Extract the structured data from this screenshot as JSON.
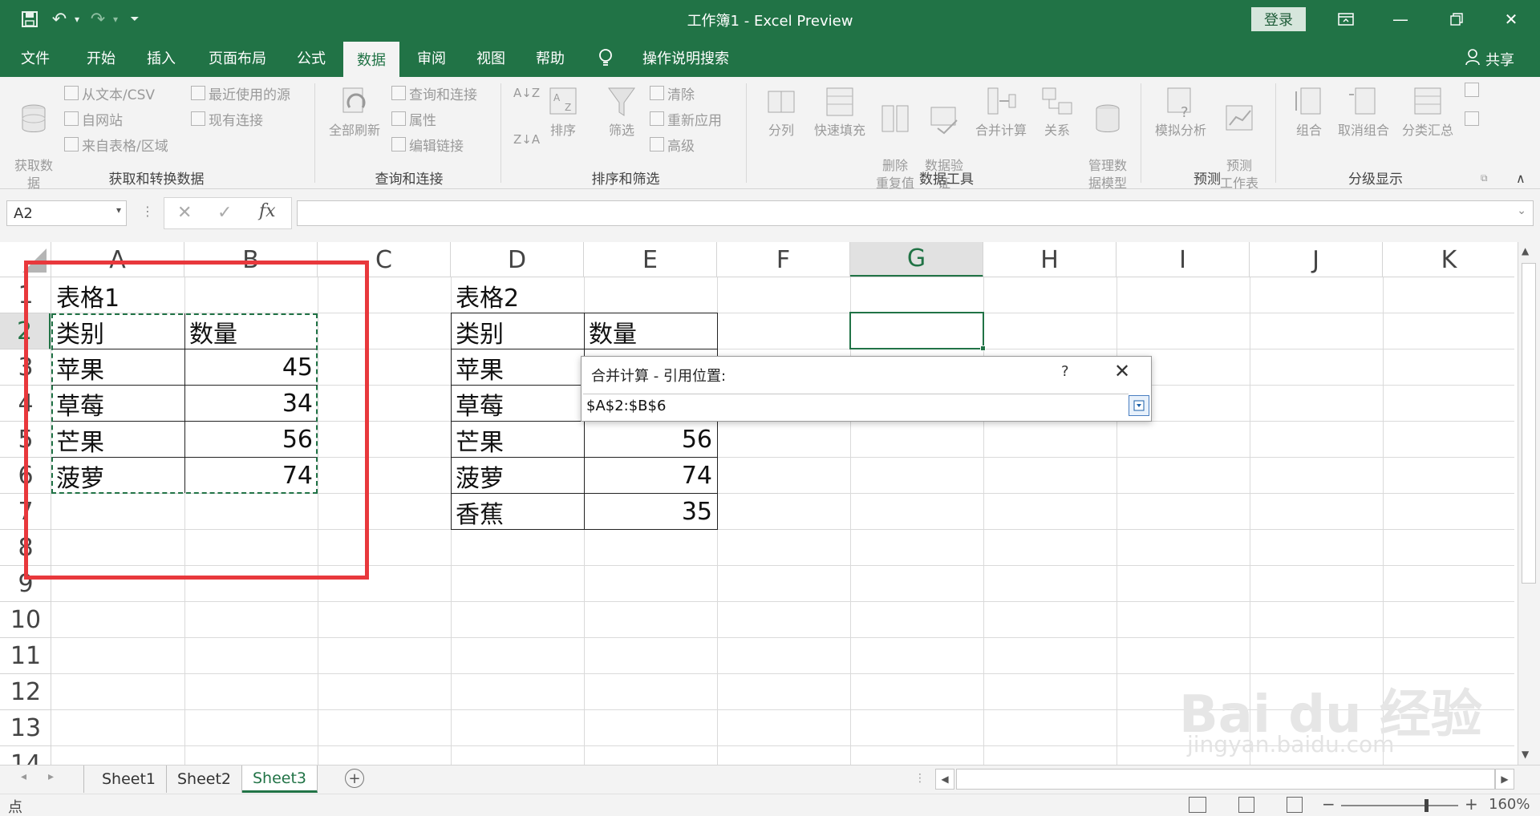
{
  "titlebar": {
    "title": "工作簿1  -  Excel Preview",
    "login": "登录",
    "undo_icon": "undo-icon",
    "redo_icon": "redo-icon",
    "save_icon": "save-icon"
  },
  "tabs": [
    "文件",
    "开始",
    "插入",
    "页面布局",
    "公式",
    "数据",
    "审阅",
    "视图",
    "帮助",
    "操作说明搜索"
  ],
  "share": "共享",
  "ribbon": {
    "get_data": "获取数\n据",
    "from_text_csv": "从文本/CSV",
    "from_web": "自网站",
    "from_table": "来自表格/区域",
    "recent_sources": "最近使用的源",
    "existing_connections": "现有连接",
    "group_get_transform": "获取和转换数据",
    "refresh_all": "全部刷新",
    "queries_connections": "查询和连接",
    "properties": "属性",
    "edit_links": "编辑链接",
    "group_queries": "查询和连接",
    "sort": "排序",
    "filter": "筛选",
    "clear": "清除",
    "reapply": "重新应用",
    "advanced": "高级",
    "group_sort_filter": "排序和筛选",
    "text_to_columns": "分列",
    "flash_fill": "快速填充",
    "remove_duplicates": "删除\n重复值",
    "data_validation": "数据验\n证",
    "consolidate": "合并计算",
    "relationships": "关系",
    "manage_data_model": "管理数\n据模型",
    "group_data_tools": "数据工具",
    "what_if": "模拟分析",
    "forecast_sheet": "预测\n工作表",
    "group_forecast": "预测",
    "group": "组合",
    "ungroup": "取消组合",
    "subtotal": "分类汇总",
    "group_outline": "分级显示"
  },
  "namebox": "A2",
  "columns": [
    "A",
    "B",
    "C",
    "D",
    "E",
    "F",
    "G",
    "H",
    "I",
    "J",
    "K"
  ],
  "rows": [
    "1",
    "2",
    "3",
    "4",
    "5",
    "6",
    "7",
    "8",
    "9",
    "10",
    "11",
    "12",
    "13",
    "14"
  ],
  "table1": {
    "title": "表格1",
    "header": [
      "类别",
      "数量"
    ],
    "rows": [
      [
        "苹果",
        "45"
      ],
      [
        "草莓",
        "34"
      ],
      [
        "芒果",
        "56"
      ],
      [
        "菠萝",
        "74"
      ]
    ]
  },
  "table2": {
    "title": "表格2",
    "header": [
      "类别",
      "数量"
    ],
    "rows": [
      [
        "苹果",
        ""
      ],
      [
        "草莓",
        ""
      ],
      [
        "芒果",
        "56"
      ],
      [
        "菠萝",
        "74"
      ],
      [
        "香蕉",
        "35"
      ]
    ]
  },
  "dialog": {
    "title": "合并计算 - 引用位置:",
    "help": "?",
    "close": "✕",
    "value": "$A$2:$B$6"
  },
  "sheets": [
    "Sheet1",
    "Sheet2",
    "Sheet3"
  ],
  "status": {
    "mode": "点",
    "zoom": "160%"
  },
  "watermark": {
    "logo": "Bai du 经验",
    "url": "jingyan.baidu.com"
  }
}
